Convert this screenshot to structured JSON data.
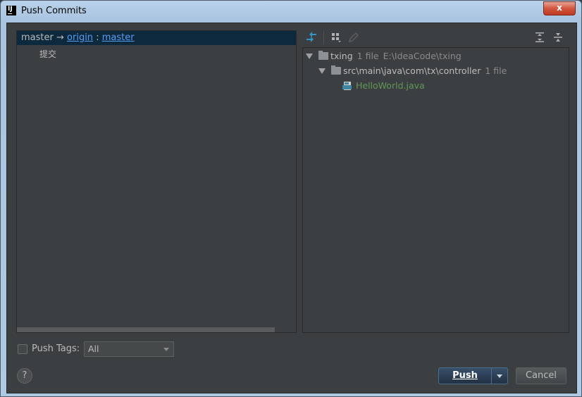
{
  "window": {
    "title": "Push Commits",
    "app_icon_text": "IJ",
    "close_label": "x"
  },
  "branch": {
    "local": "master",
    "arrow": "→",
    "remote": "origin",
    "separator": ":",
    "remote_branch": "master"
  },
  "commits": [
    {
      "message": "提交"
    }
  ],
  "changes_tree": {
    "root": {
      "name": "txing",
      "count": "1 file",
      "path": "E:\\IdeaCode\\txing"
    },
    "folder": {
      "name": "src\\main\\java\\com\\tx\\controller",
      "count": "1 file"
    },
    "file": {
      "name": "HelloWorld.java"
    }
  },
  "footer": {
    "push_tags_label": "Push Tags:",
    "push_tags_value": "All",
    "help_label": "?",
    "push_label": "Push",
    "cancel_label": "Cancel"
  },
  "colors": {
    "background": "#3c3f41",
    "selected_row": "#0d293e",
    "link": "#589df6",
    "added_file": "#629755",
    "accent_button": "#2f4560"
  },
  "icons": [
    "intellij-icon",
    "close-icon",
    "compare-arrows-icon",
    "group-by-icon",
    "edit-icon",
    "expand-all-icon",
    "collapse-all-icon",
    "folder-icon",
    "java-file-icon",
    "question-icon",
    "dropdown-caret-icon"
  ]
}
